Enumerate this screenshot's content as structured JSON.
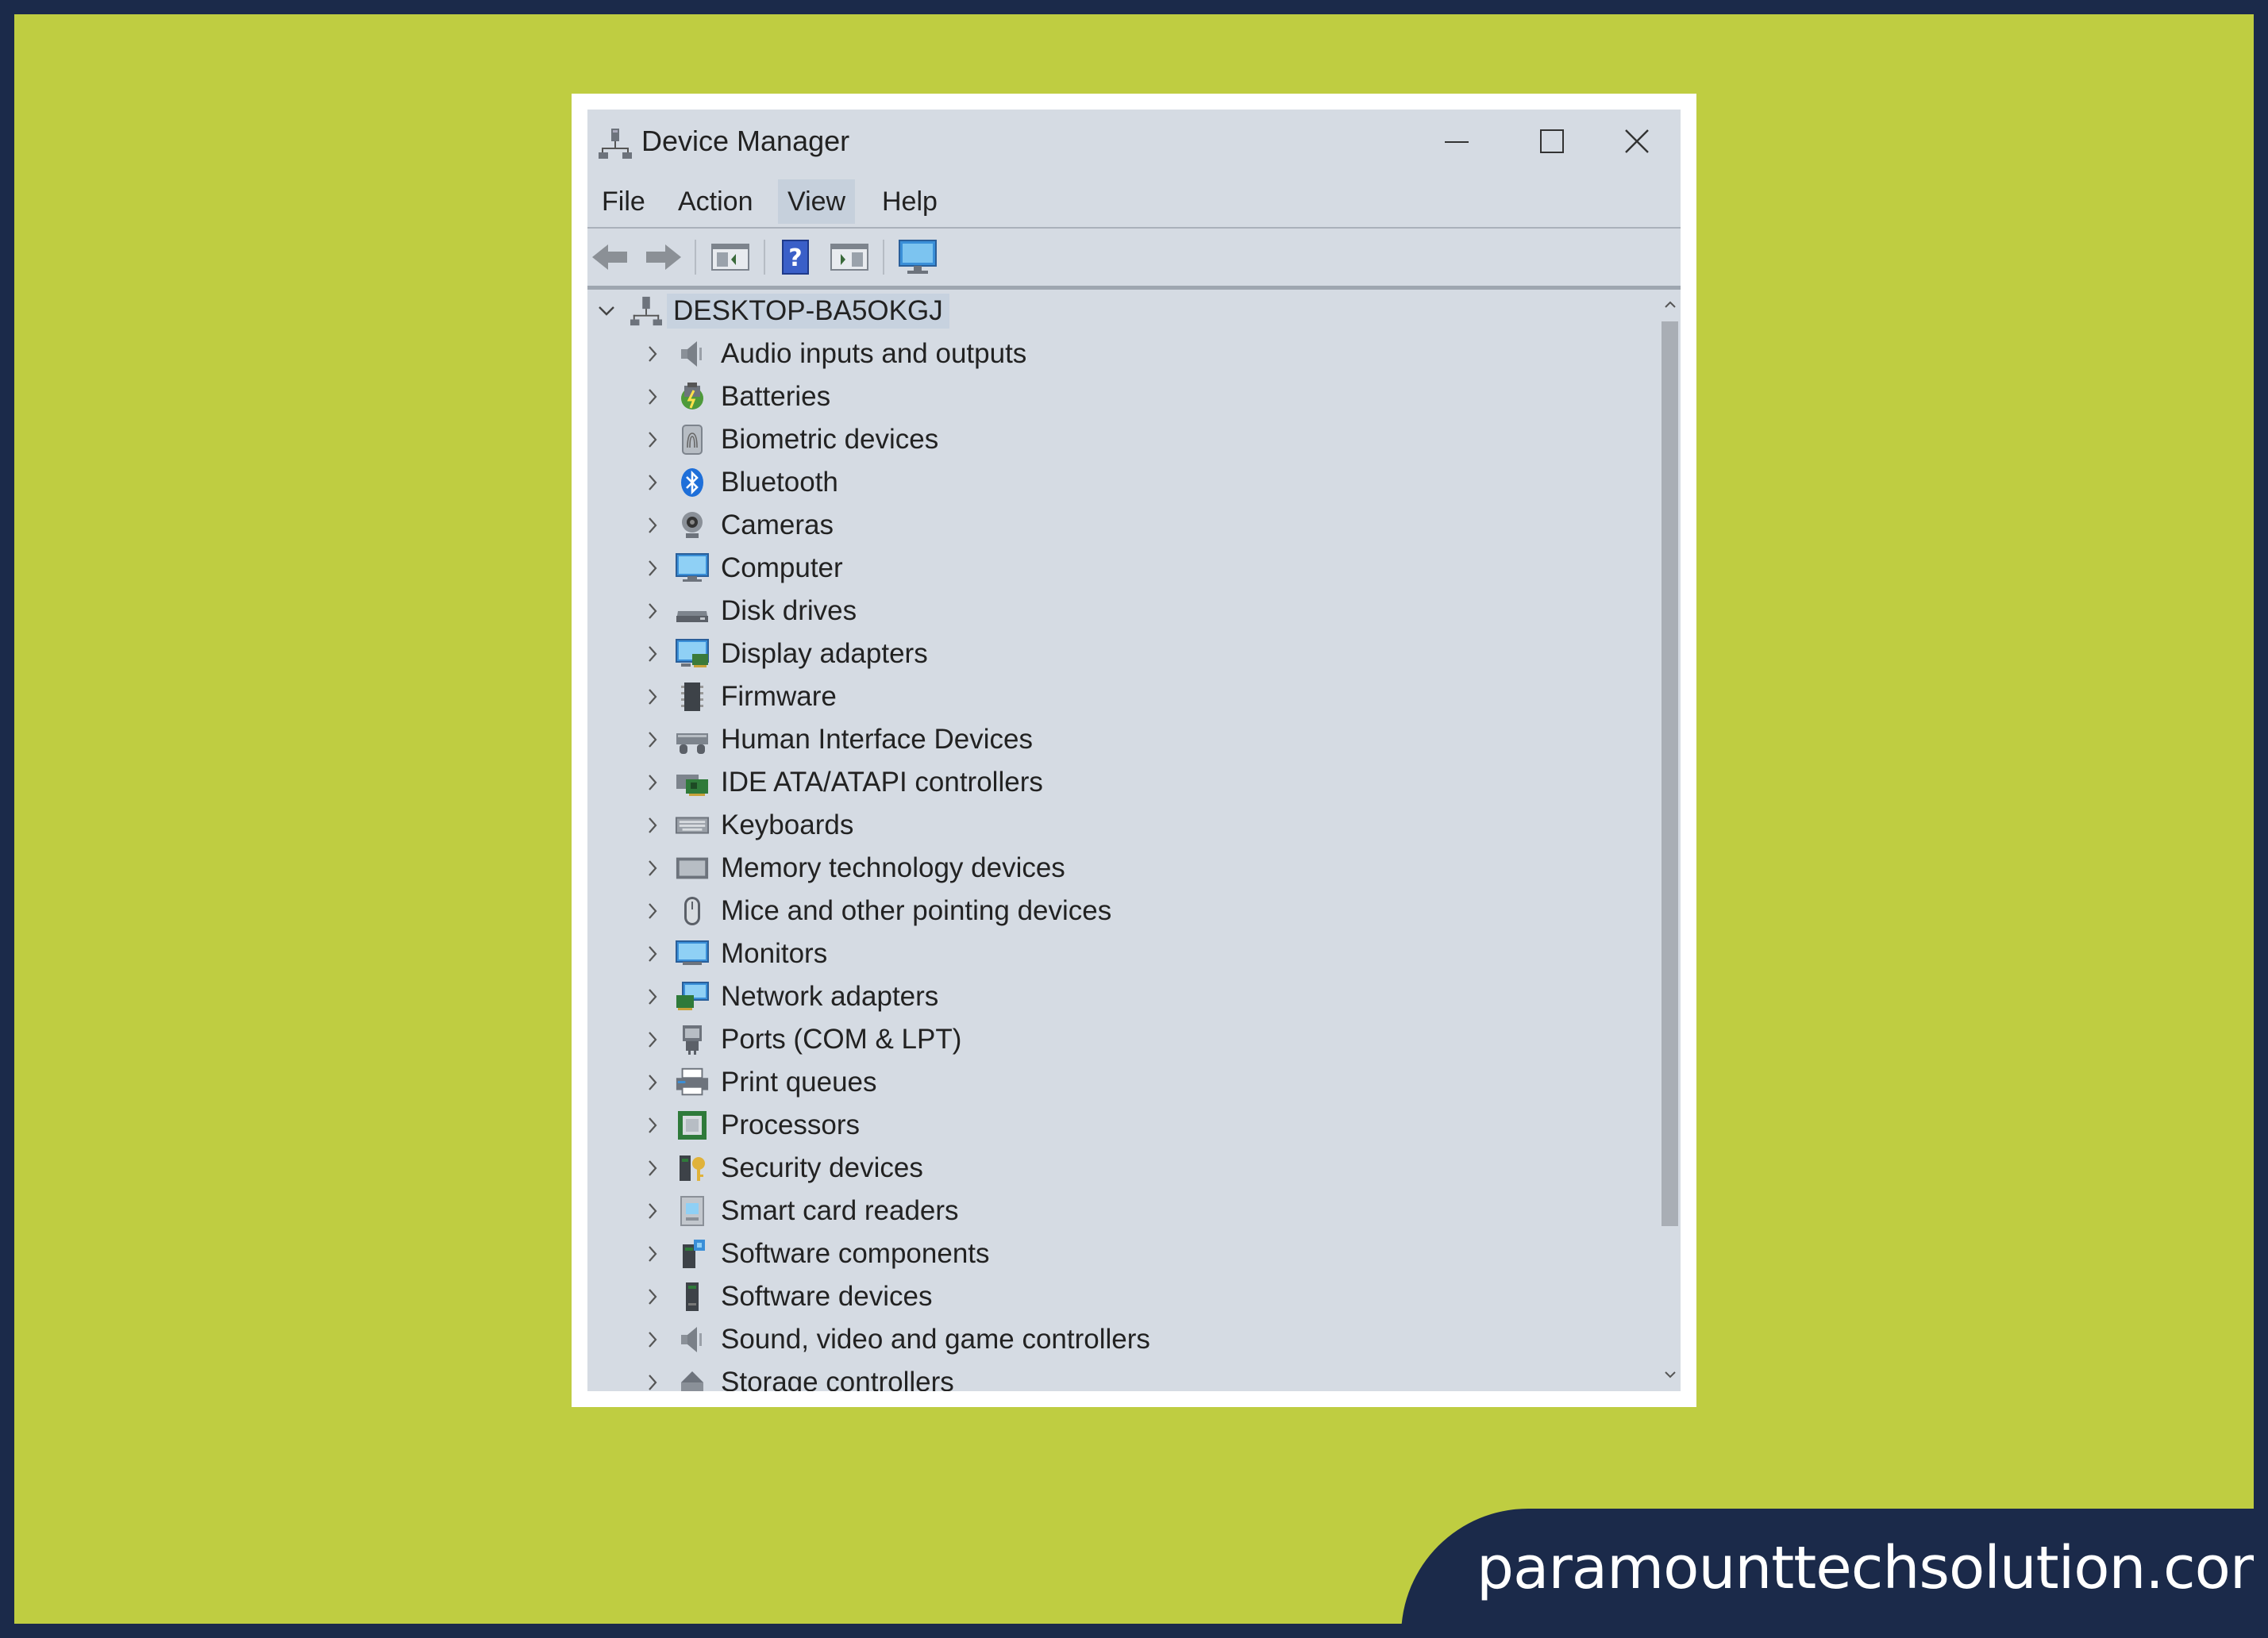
{
  "window": {
    "title": "Device Manager",
    "menu": [
      {
        "label": "File"
      },
      {
        "label": "Action"
      },
      {
        "label": "View"
      },
      {
        "label": "Help"
      }
    ]
  },
  "tree": {
    "root": {
      "label": "DESKTOP-BA5OKGJ",
      "icon": "computer-network-icon"
    },
    "items": [
      {
        "label": "Audio inputs and outputs",
        "icon": "speaker-icon"
      },
      {
        "label": "Batteries",
        "icon": "battery-icon"
      },
      {
        "label": "Biometric devices",
        "icon": "fingerprint-icon"
      },
      {
        "label": "Bluetooth",
        "icon": "bluetooth-icon"
      },
      {
        "label": "Cameras",
        "icon": "camera-icon"
      },
      {
        "label": "Computer",
        "icon": "monitor-icon"
      },
      {
        "label": "Disk drives",
        "icon": "disk-drive-icon"
      },
      {
        "label": "Display adapters",
        "icon": "display-adapter-icon"
      },
      {
        "label": "Firmware",
        "icon": "firmware-icon"
      },
      {
        "label": "Human Interface Devices",
        "icon": "hid-icon"
      },
      {
        "label": "IDE ATA/ATAPI controllers",
        "icon": "ide-controller-icon"
      },
      {
        "label": "Keyboards",
        "icon": "keyboard-icon"
      },
      {
        "label": "Memory technology devices",
        "icon": "memory-icon"
      },
      {
        "label": "Mice and other pointing devices",
        "icon": "mouse-icon"
      },
      {
        "label": "Monitors",
        "icon": "monitor-icon"
      },
      {
        "label": "Network adapters",
        "icon": "network-adapter-icon"
      },
      {
        "label": "Ports (COM & LPT)",
        "icon": "port-icon"
      },
      {
        "label": "Print queues",
        "icon": "printer-icon"
      },
      {
        "label": "Processors",
        "icon": "processor-icon"
      },
      {
        "label": "Security devices",
        "icon": "security-device-icon"
      },
      {
        "label": "Smart card readers",
        "icon": "smart-card-icon"
      },
      {
        "label": "Software components",
        "icon": "software-component-icon"
      },
      {
        "label": "Software devices",
        "icon": "software-device-icon"
      },
      {
        "label": "Sound, video and game controllers",
        "icon": "speaker-icon"
      },
      {
        "label": "Storage controllers",
        "icon": "storage-controller-icon"
      }
    ]
  },
  "banner": {
    "text": "paramounttechsolution.com"
  }
}
